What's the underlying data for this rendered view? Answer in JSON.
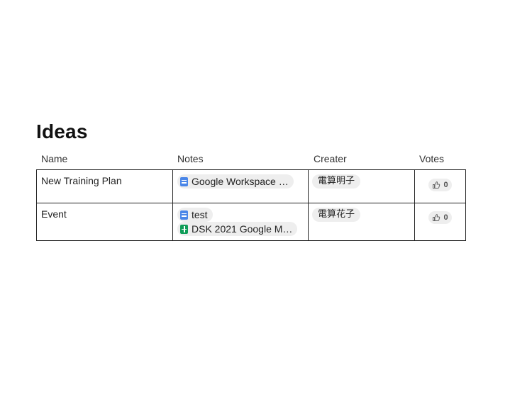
{
  "title": "Ideas",
  "columns": {
    "name": "Name",
    "notes": "Notes",
    "creater": "Creater",
    "votes": "Votes"
  },
  "rows": [
    {
      "name": "New Training Plan",
      "notes": [
        {
          "icon": "docs-icon",
          "text": "Google Workspace …"
        }
      ],
      "creater": "電算明子",
      "votes": "0"
    },
    {
      "name": "Event",
      "notes": [
        {
          "icon": "docs-icon",
          "text": "test"
        },
        {
          "icon": "sheets-icon",
          "text": "DSK 2021 Google M…"
        }
      ],
      "creater": "電算花子",
      "votes": "0"
    }
  ],
  "colors": {
    "chip_bg": "#eeeeee",
    "docs_blue": "#4a86e8",
    "sheets_green": "#0f9d58",
    "border": "#222222"
  }
}
